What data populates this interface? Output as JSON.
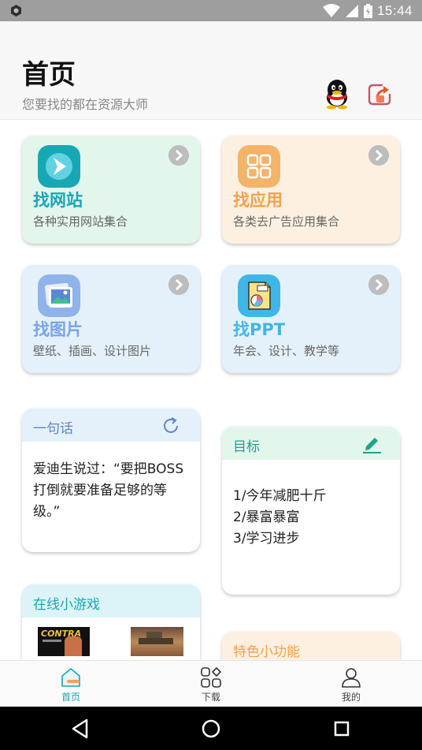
{
  "status_bar": {
    "time": "15:44"
  },
  "header": {
    "title": "首页",
    "subtitle": "您要找的都在资源大师"
  },
  "tiles": [
    {
      "title": "找网站",
      "desc": "各种实用网站集合"
    },
    {
      "title": "找应用",
      "desc": "各类去广告应用集合"
    },
    {
      "title": "找图片",
      "desc": "壁纸、插画、设计图片"
    },
    {
      "title": "找PPT",
      "desc": "年会、设计、教学等"
    }
  ],
  "quote": {
    "title": "一句话",
    "text": "爱迪生说过：“要把BOSS打倒就要准备足够的等级。”"
  },
  "goals": {
    "title": "目标",
    "items": [
      "1/今年减肥十斤",
      "2/暴富暴富",
      "3/学习进步"
    ]
  },
  "games": {
    "title": "在线小游戏",
    "logo_text": "CONTRA"
  },
  "features": {
    "title": "特色小功能"
  },
  "nav": [
    {
      "label": "首页"
    },
    {
      "label": "下载"
    },
    {
      "label": "我的"
    }
  ],
  "colors": {
    "teal": "#17a7b5",
    "orange": "#f0a24e",
    "blue": "#79a3e3",
    "ppt_blue": "#3fb6e6",
    "green_card": "#e3f6ec",
    "orange_card": "#fdf0e0",
    "blue_card": "#e4f1fb"
  },
  "icons": [
    "app-logo-icon",
    "wifi-icon",
    "signal-icon",
    "battery-icon",
    "qq-icon",
    "share-icon",
    "arrow-right-icon",
    "website-icon",
    "apps-grid-icon",
    "image-icon",
    "ppt-icon",
    "refresh-icon",
    "edit-icon",
    "home-icon",
    "download-icon",
    "profile-icon",
    "back-icon",
    "home-circle-icon",
    "recents-icon"
  ]
}
